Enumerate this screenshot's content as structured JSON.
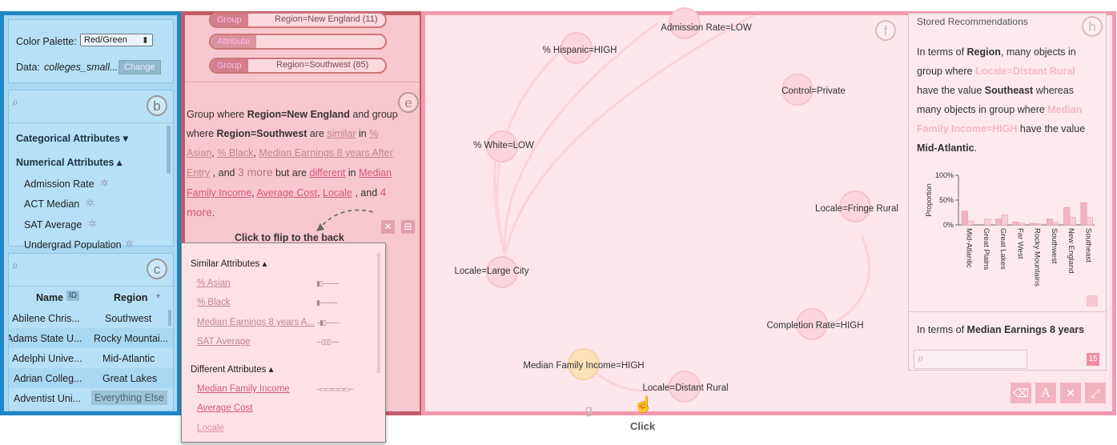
{
  "left": {
    "settings": {
      "palette_label": "Color Palette:",
      "palette_value": "Red/Green",
      "data_label": "Data:",
      "data_value": "colleges_small...",
      "change_button": "Change"
    },
    "attributes": {
      "badge": "b",
      "categorical_header": "Categorical Attributes",
      "numerical_header": "Numerical Attributes",
      "items": [
        "Admission Rate",
        "ACT Median",
        "SAT Average",
        "Undergrad Population"
      ]
    },
    "table": {
      "badge": "c",
      "col_name": "Name",
      "col_id": "ID",
      "col_region": "Region",
      "rows": [
        {
          "name": "Abilene Chris...",
          "region": "Southwest"
        },
        {
          "name": "Adams State U...",
          "region": "Rocky Mountai..."
        },
        {
          "name": "Adelphi Unive...",
          "region": "Mid-Atlantic"
        },
        {
          "name": "Adrian Colleg...",
          "region": "Great Lakes"
        },
        {
          "name": "Adventist Uni...",
          "region": "Everything Else"
        }
      ]
    }
  },
  "middle": {
    "pills": [
      {
        "label": "Group",
        "value": "Region=New England (11)"
      },
      {
        "label": "Attribute",
        "value": ""
      },
      {
        "label": "Group",
        "value": "Region=Southwest (85)"
      }
    ],
    "badge": "e",
    "desc": {
      "p1": "Group where",
      "g1": "Region=New England",
      "p2": "and group where",
      "g2": "Region=Southwest",
      "p3": "are",
      "similar": "similar",
      "p4": "in",
      "s1": "% Asian",
      "s2": "% Black",
      "s3": "Median Earnings 8 years After Entry",
      "p5": ", and",
      "more1": "3 more",
      "p6": "but are",
      "different": "different",
      "p7": "in",
      "d1": "Median Family Income",
      "d2": "Average Cost",
      "d3": "Locale",
      "p8": ", and",
      "more2": "4 more",
      "p9": "."
    },
    "flip_hint": "Click to flip to the back",
    "flip": {
      "similar_header": "Similar Attributes",
      "similar": [
        "% Asian",
        "% Black",
        "Median Earnings 8 years A...",
        "SAT Average"
      ],
      "different_header": "Different Attributes",
      "different": [
        "Median Family Income",
        "Average Cost",
        "Locale"
      ]
    }
  },
  "graph": {
    "badge": "f",
    "badge_g": "g",
    "click_label": "Click",
    "nodes": [
      {
        "label": "Admission Rate=LOW"
      },
      {
        "label": "% Hispanic=HIGH"
      },
      {
        "label": "Control=Private"
      },
      {
        "label": "% White=LOW"
      },
      {
        "label": "Locale=Fringe Rural"
      },
      {
        "label": "Locale=Large City"
      },
      {
        "label": "Completion Rate=HIGH"
      },
      {
        "label": "Median Family Income=HIGH"
      },
      {
        "label": "Locale=Distant Rural"
      }
    ]
  },
  "stored": {
    "header": "Stored Recommendations",
    "badge": "h",
    "rec1": {
      "a": "In terms of",
      "b": "Region",
      "c": ", many objects in group where",
      "d": "Locale=Distant Rural",
      "e": "have the value",
      "f": "Southeast",
      "g": "whereas many objects in group where",
      "h": "Median Family Income=HIGH",
      "i": "have the value",
      "j": "Mid-Atlantic",
      "k": "."
    },
    "rec2": {
      "a": "In terms of",
      "b": "Median Earnings 8 years"
    },
    "count": "15",
    "search_placeholder": ""
  },
  "chart_data": {
    "type": "bar",
    "ylabel": "Proportion",
    "yticks": [
      "100%",
      "50%",
      "0%"
    ],
    "ylim": [
      0,
      1
    ],
    "categories": [
      "Mid-Atlantic",
      "Great Plains",
      "Great Lakes",
      "Far West",
      "Rocky Mountains",
      "Southwest",
      "New England",
      "Southeast"
    ],
    "series": [
      {
        "values": [
          0.28,
          0.0,
          0.12,
          0.06,
          0.03,
          0.12,
          0.35,
          0.45
        ]
      },
      {
        "values": [
          0.08,
          0.12,
          0.2,
          0.04,
          0.02,
          0.05,
          0.15,
          0.15
        ]
      }
    ],
    "colors": [
      "#f2b3c0",
      "#f7cfd8"
    ]
  }
}
